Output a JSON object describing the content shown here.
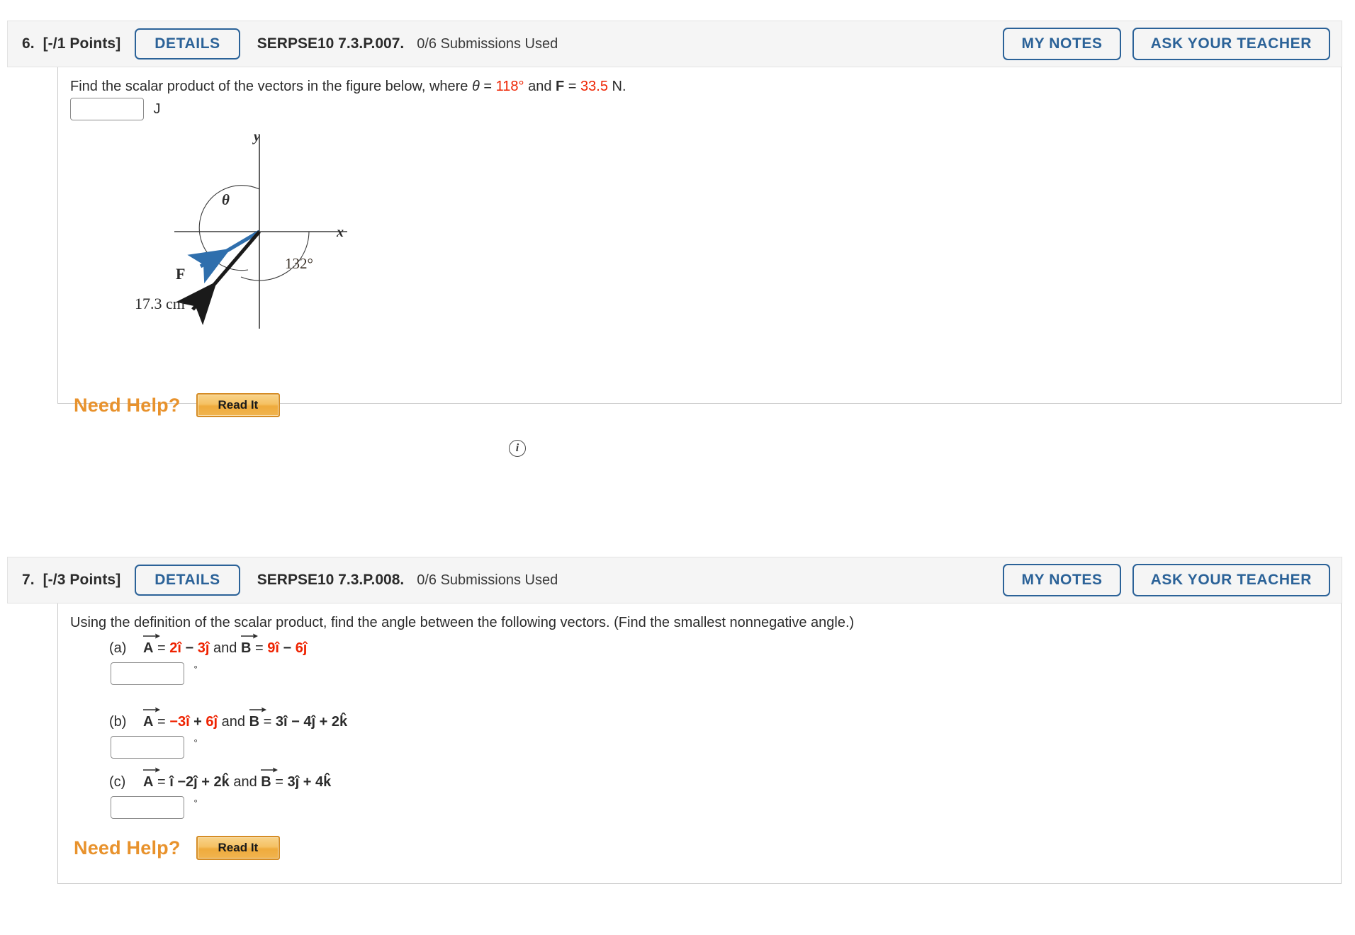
{
  "colors": {
    "accent_blue": "#2b6298",
    "value_red": "#ee2200",
    "help_orange": "#e8922c",
    "header_bg": "#f5f5f5"
  },
  "questions": [
    {
      "id": "q6",
      "number": "6.",
      "points": "[-/1 Points]",
      "details_label": "DETAILS",
      "code": "SERPSE10 7.3.P.007.",
      "submissions": "0/6 Submissions Used",
      "my_notes_label": "MY NOTES",
      "ask_teacher_label": "ASK YOUR TEACHER",
      "prompt": {
        "part1": "Find the scalar product of the vectors in the figure below, where ",
        "theta_symbol": "θ",
        "eq1": " = ",
        "theta_value": "118°",
        "mid": " and ",
        "force_symbol": "F",
        "eq2": " = ",
        "force_value": "33.5",
        "force_unit": " N."
      },
      "answer": {
        "value": "",
        "placeholder": "",
        "unit": "J"
      },
      "figure": {
        "x_axis_label": "x",
        "y_axis_label": "y",
        "theta_label": "θ",
        "angle_label": "132°",
        "force_label": "F",
        "displacement_label": "17.3 cm",
        "blue_vector_color": "#2f6fad",
        "black_vector_color": "#1a1a1a"
      },
      "info_icon": "i",
      "need_help_label": "Need Help?",
      "read_it_label": "Read It"
    },
    {
      "id": "q7",
      "number": "7.",
      "points": "[-/3 Points]",
      "details_label": "DETAILS",
      "code": "SERPSE10 7.3.P.008.",
      "submissions": "0/6 Submissions Used",
      "my_notes_label": "MY NOTES",
      "ask_teacher_label": "ASK YOUR TEACHER",
      "prompt_text": "Using the definition of the scalar product, find the angle between the following vectors. (Find the smallest nonnegative angle.)",
      "parts": [
        {
          "label": "(a)",
          "a_terms": [
            {
              "text": "2î",
              "color": "red"
            },
            {
              "text": " − ",
              "color": "black"
            },
            {
              "text": "3ĵ",
              "color": "red"
            }
          ],
          "b_terms": [
            {
              "text": "9î",
              "color": "red"
            },
            {
              "text": " − ",
              "color": "black"
            },
            {
              "text": "6ĵ",
              "color": "red"
            }
          ],
          "answer": {
            "value": "",
            "unit": "°"
          }
        },
        {
          "label": "(b)",
          "a_terms": [
            {
              "text": "−3î",
              "color": "red"
            },
            {
              "text": " + ",
              "color": "black"
            },
            {
              "text": "6ĵ",
              "color": "red"
            }
          ],
          "b_terms": [
            {
              "text": "3î − 4ĵ + 2k̂",
              "color": "black"
            }
          ],
          "answer": {
            "value": "",
            "unit": "°"
          }
        },
        {
          "label": "(c)",
          "a_terms": [
            {
              "text": "î −2ĵ + 2k̂",
              "color": "black"
            }
          ],
          "b_terms": [
            {
              "text": "3ĵ + 4k̂",
              "color": "black"
            }
          ],
          "answer": {
            "value": "",
            "unit": "°"
          }
        }
      ],
      "vector_a_symbol": "A",
      "vector_b_symbol": "B",
      "equals": "=",
      "and_word": "and",
      "need_help_label": "Need Help?",
      "read_it_label": "Read It"
    }
  ]
}
